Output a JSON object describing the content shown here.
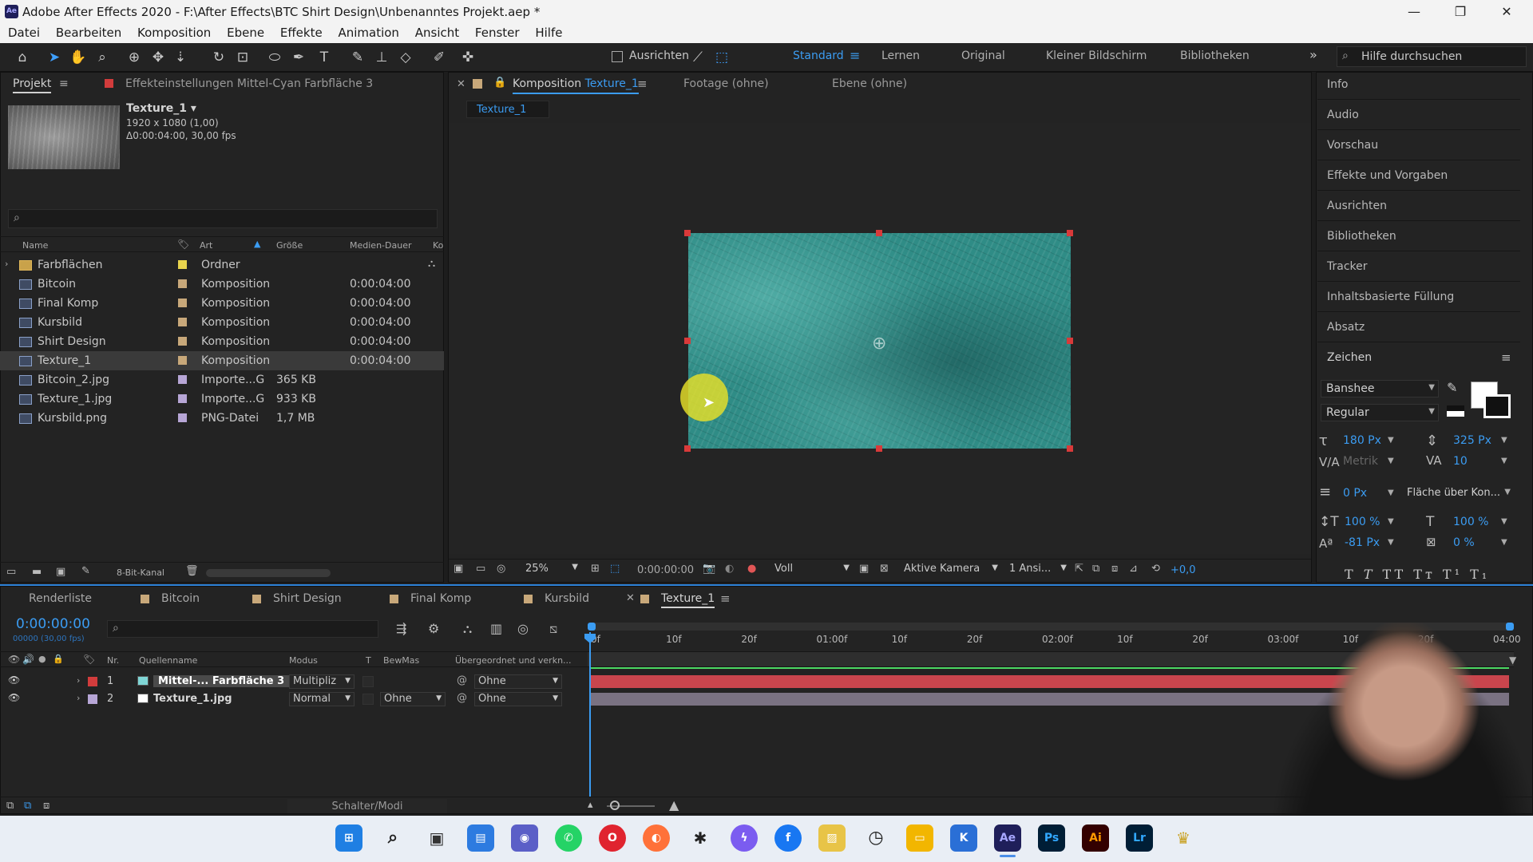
{
  "titlebar": {
    "title": "Adobe After Effects 2020 - F:\\After Effects\\BTC Shirt Design\\Unbenanntes Projekt.aep *",
    "logo": "Ae"
  },
  "menu": [
    "Datei",
    "Bearbeiten",
    "Komposition",
    "Ebene",
    "Effekte",
    "Animation",
    "Ansicht",
    "Fenster",
    "Hilfe"
  ],
  "toolbar": {
    "align_label": "Ausrichten",
    "workspaces": [
      "Standard",
      "Lernen",
      "Original",
      "Kleiner Bildschirm",
      "Bibliotheken"
    ],
    "search_placeholder": "Hilfe durchsuchen"
  },
  "project": {
    "tab": "Projekt",
    "effects_tab": "Effekteinstellungen Mittel-Cyan Farbfläche 3",
    "selected_name": "Texture_1 ▾",
    "selected_info1": "1920 x 1080 (1,00)",
    "selected_info2": "Δ0:00:04:00, 30,00 fps",
    "columns": {
      "name": "Name",
      "art": "Art",
      "size": "Größe",
      "duration": "Medien-Dauer",
      "extra": "Ko"
    },
    "items": [
      {
        "name": "Farbflächen",
        "art": "Ordner",
        "size": "",
        "dur": "",
        "color": "#e8d44d"
      },
      {
        "name": "Bitcoin",
        "art": "Komposition",
        "size": "",
        "dur": "0:00:04:00",
        "color": "#c8a87a"
      },
      {
        "name": "Final Komp",
        "art": "Komposition",
        "size": "",
        "dur": "0:00:04:00",
        "color": "#c8a87a"
      },
      {
        "name": "Kursbild",
        "art": "Komposition",
        "size": "",
        "dur": "0:00:04:00",
        "color": "#c8a87a"
      },
      {
        "name": "Shirt Design",
        "art": "Komposition",
        "size": "",
        "dur": "0:00:04:00",
        "color": "#c8a87a"
      },
      {
        "name": "Texture_1",
        "art": "Komposition",
        "size": "",
        "dur": "0:00:04:00",
        "color": "#c8a87a"
      },
      {
        "name": "Bitcoin_2.jpg",
        "art": "Importe...G",
        "size": "365 KB",
        "dur": "",
        "color": "#b7a6d6"
      },
      {
        "name": "Texture_1.jpg",
        "art": "Importe...G",
        "size": "933 KB",
        "dur": "",
        "color": "#b7a6d6"
      },
      {
        "name": "Kursbild.png",
        "art": "PNG-Datei",
        "size": "1,7 MB",
        "dur": "",
        "color": "#b7a6d6"
      }
    ],
    "bit_depth": "8-Bit-Kanal"
  },
  "comp": {
    "tab_prefix": "Komposition",
    "tab_name": "Texture_1",
    "footage_tab": "Footage (ohne)",
    "layer_tab": "Ebene (ohne)",
    "breadcrumb": "Texture_1",
    "zoom": "25%",
    "timecode": "0:00:00:00",
    "resolution": "Voll",
    "camera": "Aktive Kamera",
    "views": "1 Ansi...",
    "exposure": "+0,0"
  },
  "right_panel": {
    "items": [
      "Info",
      "Audio",
      "Vorschau",
      "Effekte und Vorgaben",
      "Ausrichten",
      "Bibliotheken",
      "Tracker",
      "Inhaltsbasierte Füllung",
      "Absatz",
      "Zeichen"
    ],
    "font": "Banshee",
    "style": "Regular",
    "font_size": "180 Px",
    "leading": "325 Px",
    "kerning": "Metrik",
    "tracking": "10",
    "stroke": "0 Px",
    "stroke_mode": "Fläche über Kon...",
    "vscale": "100 %",
    "hscale": "100 %",
    "baseline": "-81 Px",
    "tsume": "0 %",
    "text_styles": [
      "T",
      "T",
      "TT",
      "Tт",
      "T¹",
      "T₁"
    ]
  },
  "timeline": {
    "tabs": [
      "Renderliste",
      "Bitcoin",
      "Shirt Design",
      "Final Komp",
      "Kursbild",
      "Texture_1"
    ],
    "tab_colors": [
      "",
      "#c8a87a",
      "#c8a87a",
      "#c8a87a",
      "#c8a87a",
      "#c8a87a"
    ],
    "timecode": "0:00:00:00",
    "frames": "00000 (30,00 fps)",
    "columns": {
      "nr": "Nr.",
      "source": "Quellenname",
      "mode": "Modus",
      "t": "T",
      "trkmat": "BewMas",
      "parent": "Übergeordnet und verkn..."
    },
    "layers": [
      {
        "nr": "1",
        "name": "Mittel-... Farbfläche 3",
        "mode": "Multipliz",
        "trkmat": "",
        "parent": "Ohne",
        "label": "#d23c3c",
        "icon": "#7fd6d6"
      },
      {
        "nr": "2",
        "name": "Texture_1.jpg",
        "mode": "Normal",
        "trkmat": "Ohne",
        "parent": "Ohne",
        "label": "#b7a6d6",
        "icon": "#ffffff"
      }
    ],
    "ruler": [
      "0f",
      "10f",
      "20f",
      "01:00f",
      "10f",
      "20f",
      "02:00f",
      "10f",
      "20f",
      "03:00f",
      "10f",
      "20f",
      "04:00"
    ],
    "switches": "Schalter/Modi"
  },
  "taskbar": [
    "windows-start",
    "search",
    "task-view",
    "widgets",
    "teams",
    "whatsapp",
    "opera",
    "firefox",
    "app-figure",
    "messenger",
    "facebook",
    "photos",
    "clock",
    "explorer",
    "app-k",
    "Ae",
    "Ps",
    "Ai",
    "Lr",
    "app-misc"
  ]
}
